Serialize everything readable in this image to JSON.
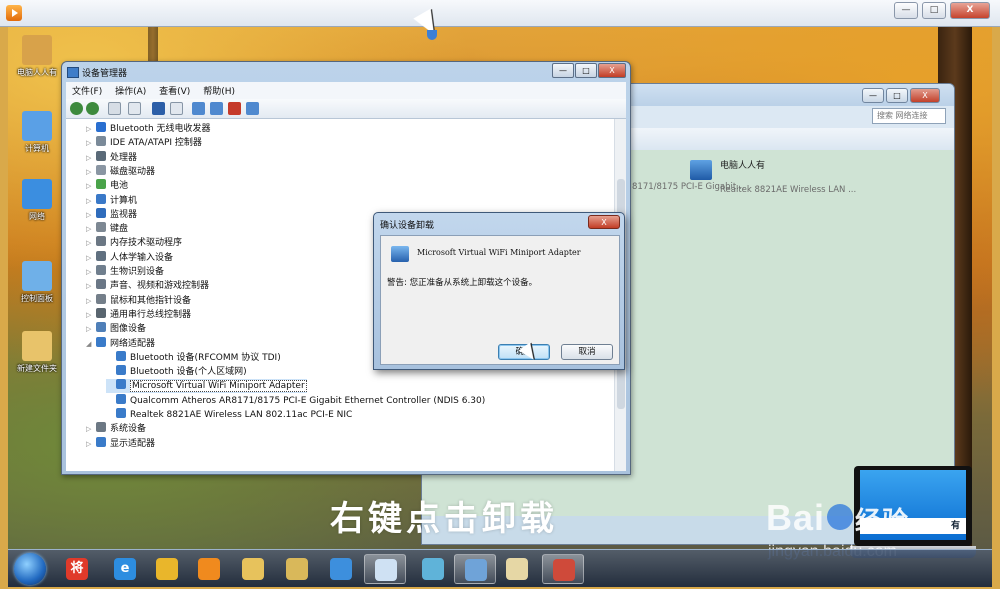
{
  "player": {
    "title": "",
    "buttons": [
      "—",
      "□",
      "X"
    ]
  },
  "desktop": {
    "icons": [
      {
        "label": "电脑人人有",
        "color": "#d8a24a"
      },
      {
        "label": "计算机",
        "color": "#5aa0e6"
      },
      {
        "label": "网络",
        "color": "#3b8ee0"
      },
      {
        "label": "控制面板",
        "color": "#6fb0e8"
      },
      {
        "label": "新建文件夹",
        "color": "#e8c36a"
      }
    ]
  },
  "explorer": {
    "search_placeholder": "搜索 网络连接",
    "items": [
      {
        "name": "8171/8175 PCI-E Gigabit...",
        "sub": ""
      },
      {
        "name": "电脑人人有",
        "sub": "Realtek 8821AE Wireless LAN ..."
      }
    ],
    "overlay_text": "右键点击卸载"
  },
  "devmgr": {
    "title": "设备管理器",
    "menu": [
      "文件(F)",
      "操作(A)",
      "查看(V)",
      "帮助(H)"
    ],
    "window_buttons": [
      "—",
      "□",
      "X"
    ],
    "tree": [
      {
        "label": "Bluetooth 无线电收发器",
        "level": 1,
        "expanded": false,
        "icon": "bluetooth-icon",
        "color": "#2a6fd0"
      },
      {
        "label": "IDE ATA/ATAPI 控制器",
        "level": 1,
        "expanded": false,
        "icon": "ide-icon",
        "color": "#7a8a99"
      },
      {
        "label": "处理器",
        "level": 1,
        "expanded": false,
        "icon": "cpu-icon",
        "color": "#5a6a78"
      },
      {
        "label": "磁盘驱动器",
        "level": 1,
        "expanded": false,
        "icon": "disk-icon",
        "color": "#8a96a3"
      },
      {
        "label": "电池",
        "level": 1,
        "expanded": false,
        "icon": "battery-icon",
        "color": "#4aa34a"
      },
      {
        "label": "计算机",
        "level": 1,
        "expanded": false,
        "icon": "computer-icon",
        "color": "#3a79c8"
      },
      {
        "label": "监视器",
        "level": 1,
        "expanded": false,
        "icon": "monitor-icon",
        "color": "#2f6cbc"
      },
      {
        "label": "键盘",
        "level": 1,
        "expanded": false,
        "icon": "keyboard-icon",
        "color": "#7d8893"
      },
      {
        "label": "内存技术驱动程序",
        "level": 1,
        "expanded": false,
        "icon": "memory-icon",
        "color": "#6b7784"
      },
      {
        "label": "人体学输入设备",
        "level": 1,
        "expanded": false,
        "icon": "hid-icon",
        "color": "#607080"
      },
      {
        "label": "生物识别设备",
        "level": 1,
        "expanded": false,
        "icon": "fingerprint-icon",
        "color": "#707f8e"
      },
      {
        "label": "声音、视频和游戏控制器",
        "level": 1,
        "expanded": false,
        "icon": "sound-icon",
        "color": "#6a7786"
      },
      {
        "label": "鼠标和其他指针设备",
        "level": 1,
        "expanded": false,
        "icon": "mouse-icon",
        "color": "#747f8a"
      },
      {
        "label": "通用串行总线控制器",
        "level": 1,
        "expanded": false,
        "icon": "usb-icon",
        "color": "#59656f"
      },
      {
        "label": "图像设备",
        "level": 1,
        "expanded": false,
        "icon": "camera-icon",
        "color": "#4f7fb8"
      },
      {
        "label": "网络适配器",
        "level": 1,
        "expanded": true,
        "icon": "network-adapter-icon",
        "color": "#3a7bc9"
      },
      {
        "label": "Bluetooth 设备(RFCOMM 协议 TDI)",
        "level": 2,
        "expanded": false,
        "icon": "adapter-icon",
        "color": "#3a7bc9"
      },
      {
        "label": "Bluetooth 设备(个人区域网)",
        "level": 2,
        "expanded": false,
        "icon": "adapter-icon",
        "color": "#3a7bc9"
      },
      {
        "label": "Microsoft Virtual WiFi Miniport Adapter",
        "level": 2,
        "expanded": false,
        "icon": "adapter-icon",
        "color": "#3a7bc9",
        "selected": true
      },
      {
        "label": "Qualcomm Atheros AR8171/8175 PCI-E Gigabit Ethernet Controller (NDIS 6.30)",
        "level": 2,
        "expanded": false,
        "icon": "adapter-icon",
        "color": "#3a7bc9"
      },
      {
        "label": "Realtek 8821AE Wireless LAN 802.11ac PCI-E NIC",
        "level": 2,
        "expanded": false,
        "icon": "adapter-icon",
        "color": "#3a7bc9"
      },
      {
        "label": "系统设备",
        "level": 1,
        "expanded": false,
        "icon": "system-icon",
        "color": "#6c7884"
      },
      {
        "label": "显示适配器",
        "level": 1,
        "expanded": false,
        "icon": "display-adapter-icon",
        "color": "#3a7bc9"
      }
    ]
  },
  "dialog": {
    "title": "确认设备卸载",
    "device_name": "Microsoft Virtual WiFi Miniport Adapter",
    "warning": "警告: 您正准备从系统上卸载这个设备。",
    "ok": "确定",
    "cancel": "取消",
    "close": "X"
  },
  "watermark": {
    "logo_left": "Bai",
    "logo_right": "经验",
    "url": "jingyan.baidu.com",
    "laptop_label": "有"
  },
  "taskbar": {
    "items": [
      {
        "name": "jiang-app-icon",
        "color": "#e03a2a",
        "active": false,
        "glyph": "将"
      },
      {
        "name": "ie-icon",
        "color": "#2d8de0",
        "active": false,
        "glyph": "e"
      },
      {
        "name": "chrome-icon",
        "color": "#e9b62b",
        "active": false,
        "glyph": ""
      },
      {
        "name": "media-player-icon",
        "color": "#f08a1e",
        "active": false,
        "glyph": ""
      },
      {
        "name": "explorer-icon",
        "color": "#e7c25c",
        "active": false,
        "glyph": ""
      },
      {
        "name": "folder-icon",
        "color": "#d9b85a",
        "active": false,
        "glyph": ""
      },
      {
        "name": "search-app-icon",
        "color": "#3d8fdd",
        "active": false,
        "glyph": ""
      },
      {
        "name": "document-icon",
        "color": "#cfe1f3",
        "active": true,
        "glyph": ""
      },
      {
        "name": "tools-icon",
        "color": "#5fb3d9",
        "active": false,
        "glyph": ""
      },
      {
        "name": "network-center-icon",
        "color": "#6fa3d8",
        "active": true,
        "glyph": ""
      },
      {
        "name": "paint-icon",
        "color": "#e6d7a5",
        "active": false,
        "glyph": ""
      },
      {
        "name": "toolbox-icon",
        "color": "#cf4a3a",
        "active": true,
        "glyph": ""
      }
    ]
  }
}
